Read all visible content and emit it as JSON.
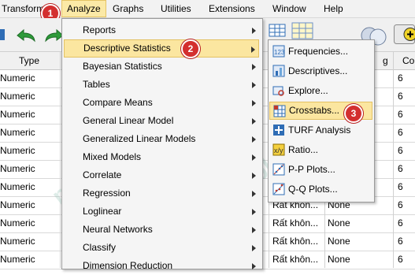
{
  "menubar": {
    "items": [
      "Transform",
      "Analyze",
      "Graphs",
      "Utilities",
      "Extensions",
      "Window",
      "Help"
    ]
  },
  "grid": {
    "header": {
      "type": "Type",
      "g": "g",
      "co": "Co"
    },
    "rows": [
      {
        "type": "Numeric",
        "co": "6"
      },
      {
        "type": "Numeric",
        "co": "6"
      },
      {
        "type": "Numeric",
        "co": "6"
      },
      {
        "type": "Numeric",
        "co": "6"
      },
      {
        "type": "Numeric",
        "co": "6"
      },
      {
        "type": "Numeric",
        "co": "6"
      },
      {
        "type": "Numeric",
        "co": "6"
      },
      {
        "type": "Numeric",
        "co": "6"
      },
      {
        "type": "Numeric",
        "co": "6"
      },
      {
        "type": "Numeric",
        "co": "6"
      },
      {
        "type": "Numeric",
        "co": "6"
      }
    ],
    "value_rows": [
      {
        "label": "Rất khôn...",
        "missing": "None"
      },
      {
        "label": "Rất khôn...",
        "missing": "None"
      },
      {
        "label": "Rất khôn...",
        "missing": "None"
      },
      {
        "label": "Rất khôn...",
        "missing": "None"
      }
    ]
  },
  "analyze_menu": {
    "items": [
      {
        "label": "Reports",
        "submenu": true
      },
      {
        "label": "Descriptive Statistics",
        "submenu": true
      },
      {
        "label": "Bayesian Statistics",
        "submenu": true
      },
      {
        "label": "Tables",
        "submenu": true
      },
      {
        "label": "Compare Means",
        "submenu": true
      },
      {
        "label": "General Linear Model",
        "submenu": true
      },
      {
        "label": "Generalized Linear Models",
        "submenu": true
      },
      {
        "label": "Mixed Models",
        "submenu": true
      },
      {
        "label": "Correlate",
        "submenu": true
      },
      {
        "label": "Regression",
        "submenu": true
      },
      {
        "label": "Loglinear",
        "submenu": true
      },
      {
        "label": "Neural Networks",
        "submenu": true
      },
      {
        "label": "Classify",
        "submenu": true
      },
      {
        "label": "Dimension Reduction",
        "submenu": true
      }
    ]
  },
  "descriptive_submenu": {
    "items": [
      {
        "label": "Frequencies...",
        "icon": "frequencies-icon"
      },
      {
        "label": "Descriptives...",
        "icon": "descriptives-icon"
      },
      {
        "label": "Explore...",
        "icon": "explore-icon"
      },
      {
        "label": "Crosstabs...",
        "icon": "crosstabs-icon"
      },
      {
        "label": "TURF Analysis",
        "icon": "turf-icon"
      },
      {
        "label": "Ratio...",
        "icon": "ratio-icon"
      },
      {
        "label": "P-P Plots...",
        "icon": "pp-plot-icon"
      },
      {
        "label": "Q-Q Plots...",
        "icon": "qq-plot-icon"
      }
    ]
  },
  "badges": [
    "1",
    "2",
    "3"
  ],
  "watermark": "phamlocblog.com",
  "colors": {
    "highlight": "#fbe6a0",
    "badge": "#d32f2f",
    "accent_icon": "#2f6db5"
  }
}
